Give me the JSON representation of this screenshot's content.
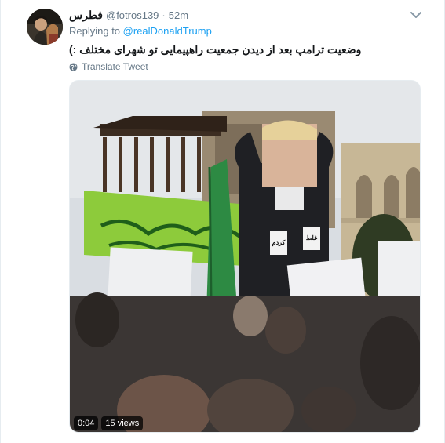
{
  "tweet": {
    "display_name": "فطرس",
    "handle": "@fotros139",
    "separator": "·",
    "time": "52m",
    "replying_prefix": "Replying to",
    "replying_to": "@realDonaldTrump",
    "text": "وضعیت ترامپ بعد از دیدن جمعیت راهپیمایی تو شهرای مختلف :)",
    "translate_label": "Translate Tweet"
  },
  "video": {
    "duration": "0:04",
    "views": "15 views",
    "sign_left": "کردم",
    "sign_right": "غلط"
  },
  "icons": {
    "menu": "chevron-down-icon",
    "translate": "globe-icon"
  },
  "colors": {
    "link": "#1da1f2",
    "secondary_text": "#657786",
    "primary_text": "#14171a"
  }
}
